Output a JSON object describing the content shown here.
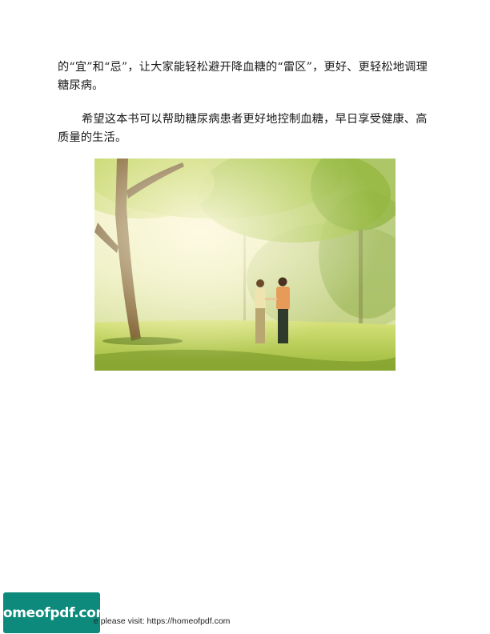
{
  "paragraphs": {
    "p1": "的“宜”和“忌”，让大家能轻松避开降血糖的“雷区”，更好、更轻松地调理糖尿病。",
    "p2": "希望这本书可以帮助糖尿病患者更好地控制血糖，早日享受健康、高质量的生活。"
  },
  "figure": {
    "subject": "two women walking hand in hand in a sunlit park"
  },
  "watermark": {
    "logo_text": "homeofpdf.com",
    "footer": "e please visit: https://homeofpdf.com"
  }
}
